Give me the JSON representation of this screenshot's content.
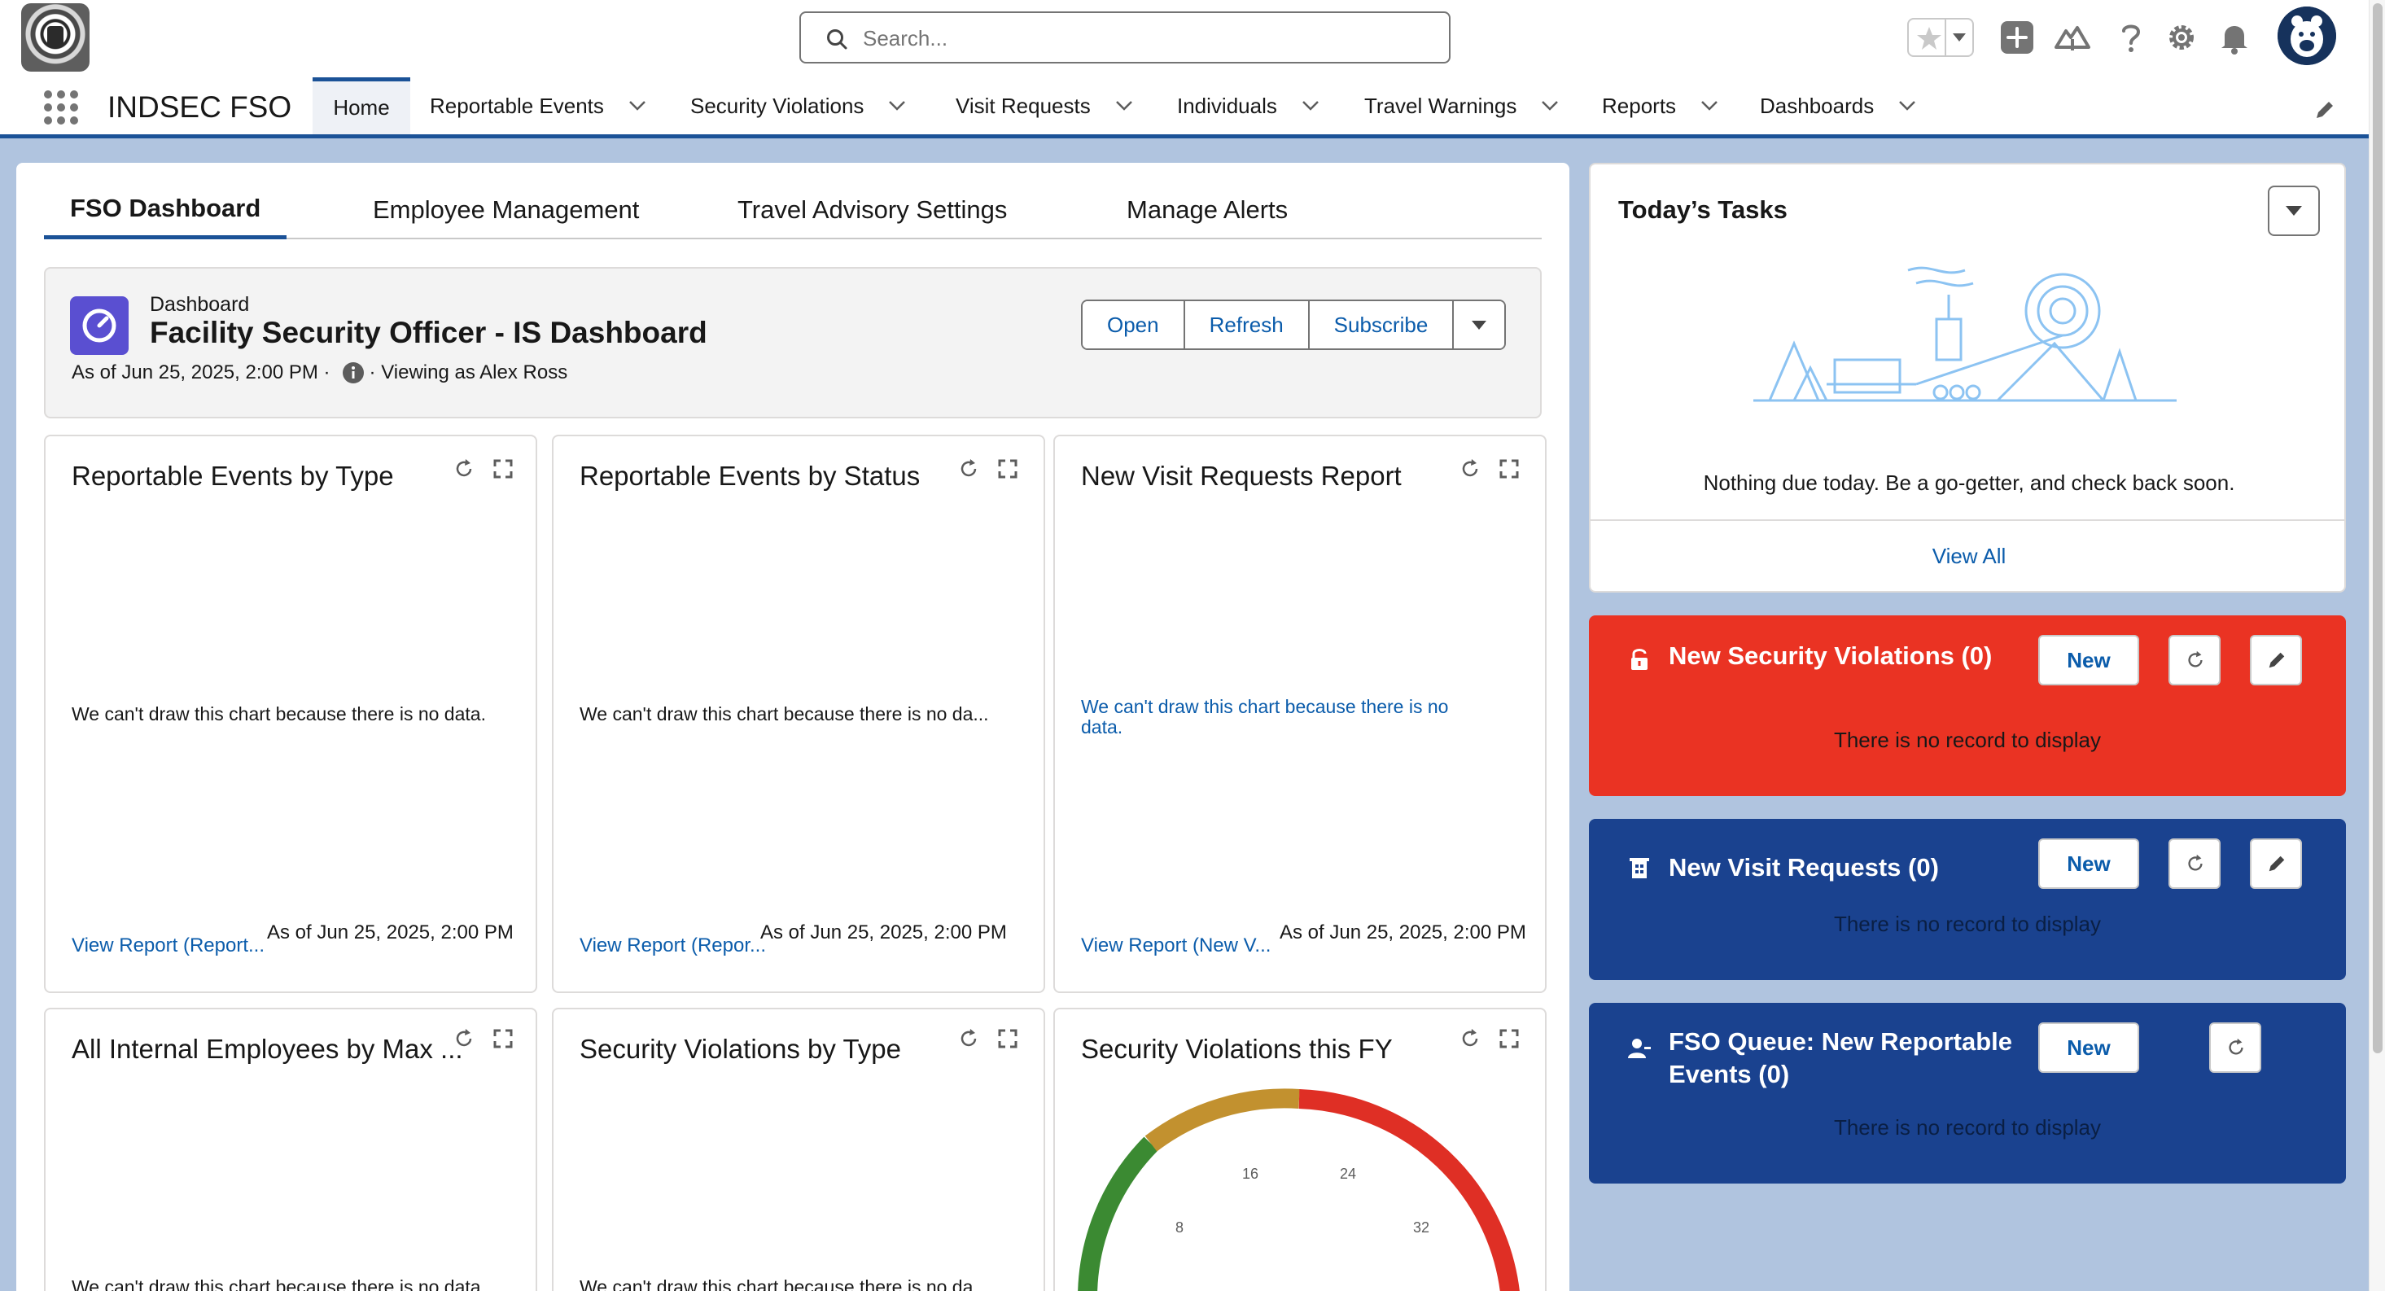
{
  "app": {
    "name": "INDSEC FSO"
  },
  "search": {
    "placeholder": "Search..."
  },
  "nav": {
    "items": [
      {
        "label": "Home"
      },
      {
        "label": "Reportable Events"
      },
      {
        "label": "Security Violations"
      },
      {
        "label": "Visit Requests"
      },
      {
        "label": "Individuals"
      },
      {
        "label": "Travel Warnings"
      },
      {
        "label": "Reports"
      },
      {
        "label": "Dashboards"
      }
    ]
  },
  "tabs": [
    {
      "label": "FSO Dashboard"
    },
    {
      "label": "Employee Management"
    },
    {
      "label": "Travel Advisory Settings"
    },
    {
      "label": "Manage Alerts"
    }
  ],
  "dashboard": {
    "kicker": "Dashboard",
    "title": "Facility Security Officer - IS Dashboard",
    "as_of": "As of Jun 25, 2025, 2:00 PM ·",
    "viewing_as": "· Viewing as Alex Ross",
    "buttons": {
      "open": "Open",
      "refresh": "Refresh",
      "subscribe": "Subscribe"
    }
  },
  "cards": [
    {
      "title": "Reportable Events by Type",
      "message": "We can't draw this chart because there is no data.",
      "link": "View Report (Report...",
      "as_of": "As of Jun 25, 2025, 2:00 PM"
    },
    {
      "title": "Reportable Events by Status",
      "message": "We can't draw this chart because there is no da...",
      "link": "View Report (Repor...",
      "as_of": "As of Jun 25, 2025, 2:00 PM"
    },
    {
      "title": "New Visit Requests Report",
      "message": "We can't draw this chart because there is no data.",
      "link": "View Report (New V...",
      "as_of": "As of Jun 25, 2025, 2:00 PM"
    },
    {
      "title": "All Internal Employees by Max ...",
      "message": "We can't draw this chart because there is no data."
    },
    {
      "title": "Security Violations by Type",
      "message": "We can't draw this chart because there is no da..."
    },
    {
      "title": "Security Violations this FY",
      "gauge_labels": [
        "8",
        "16",
        "24",
        "32"
      ]
    }
  ],
  "tasks": {
    "title": "Today’s Tasks",
    "empty": "Nothing due today. Be a go-getter, and check back soon.",
    "view_all": "View All"
  },
  "lists": [
    {
      "title": "New Security Violations (0)",
      "new_label": "New",
      "empty": "There is no record to display",
      "color": "#ea3323"
    },
    {
      "title": "New Visit Requests (0)",
      "new_label": "New",
      "empty": "There is no record to display",
      "color": "#1a428f"
    },
    {
      "title": "FSO Queue: New Reportable Events (0)",
      "new_label": "New",
      "empty": "There is no record to display",
      "color": "#1a428f"
    }
  ]
}
